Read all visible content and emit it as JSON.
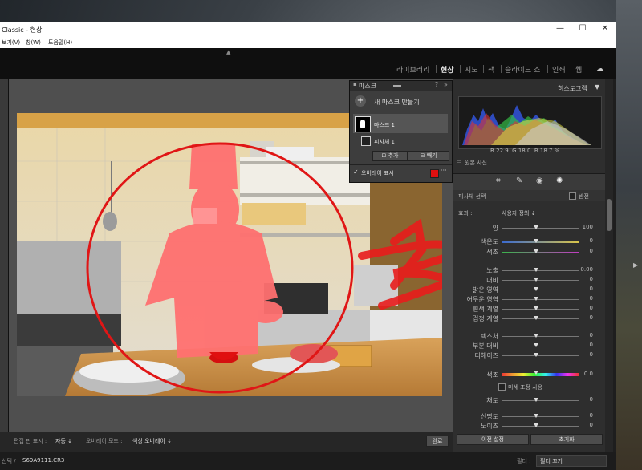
{
  "window": {
    "title": "Classic - 현상",
    "menu": [
      "보기(V)",
      "창(W)",
      "도움말(H)"
    ],
    "minimize": "—",
    "maximize": "☐",
    "close": "✕"
  },
  "modules": [
    "라이브러리",
    "현상",
    "지도",
    "책",
    "슬라이드 쇼",
    "인쇄",
    "웹"
  ],
  "active_module": "현상",
  "histogram": {
    "title": "히스토그램",
    "readout": {
      "r_label": "R",
      "r": "22.9",
      "g_label": "G",
      "g": "18.0",
      "b_label": "B",
      "b": "18.7",
      "unit": "%"
    },
    "original_photo": "원본 사진"
  },
  "mask_panel": {
    "title": "마스크",
    "new_mask": "새 마스크 만들기",
    "mask_name": "마스크 1",
    "subject_name": "피사체 1",
    "add": "추가",
    "subtract": "빼기",
    "overlay_label": "오버레이 표시",
    "overlay_color": "#e01010"
  },
  "subject_panel": {
    "title": "피사체 선택",
    "invert": "반전",
    "effect_label": "효과 :",
    "effect_value": "사용자 정의 ⇣",
    "amount_label": "양",
    "amount_value": "100"
  },
  "sliders": [
    {
      "label": "색온도",
      "value": "0"
    },
    {
      "label": "색조",
      "value": "0"
    },
    {
      "label": "노출",
      "value": "0.00"
    },
    {
      "label": "대비",
      "value": "0"
    },
    {
      "label": "밝은 영역",
      "value": "0"
    },
    {
      "label": "어두운 영역",
      "value": "0"
    },
    {
      "label": "흰색 계열",
      "value": "0"
    },
    {
      "label": "검정 계열",
      "value": "0"
    },
    {
      "label": "텍스처",
      "value": "0"
    },
    {
      "label": "부분 대비",
      "value": "0"
    },
    {
      "label": "디헤이즈",
      "value": "0"
    },
    {
      "label": "색조",
      "value": "0.0"
    },
    {
      "label": "채도",
      "value": "0"
    },
    {
      "label": "선명도",
      "value": "0"
    },
    {
      "label": "노이즈",
      "value": "0"
    }
  ],
  "fine_tune": "미세 조정 사용",
  "bottom_bar": {
    "show_pins_label": "편집 핀 표시 :",
    "show_pins_value": "자동 ⇣",
    "overlay_mode_label": "오버레이 모드 :",
    "overlay_mode_value": "색상 오버레이 ⇣",
    "done": "완료"
  },
  "right_buttons": {
    "previous": "이전 설정",
    "reset": "초기화"
  },
  "filmstrip": {
    "selection_label": "선택 /",
    "filename": "S69A9111.CR3",
    "filter_label": "필터 :",
    "filter_value": "필터 끄기"
  },
  "colors": {
    "accent": "#e01010",
    "panel": "#2e2e2e",
    "overlay_red": "#ff3b3b"
  }
}
